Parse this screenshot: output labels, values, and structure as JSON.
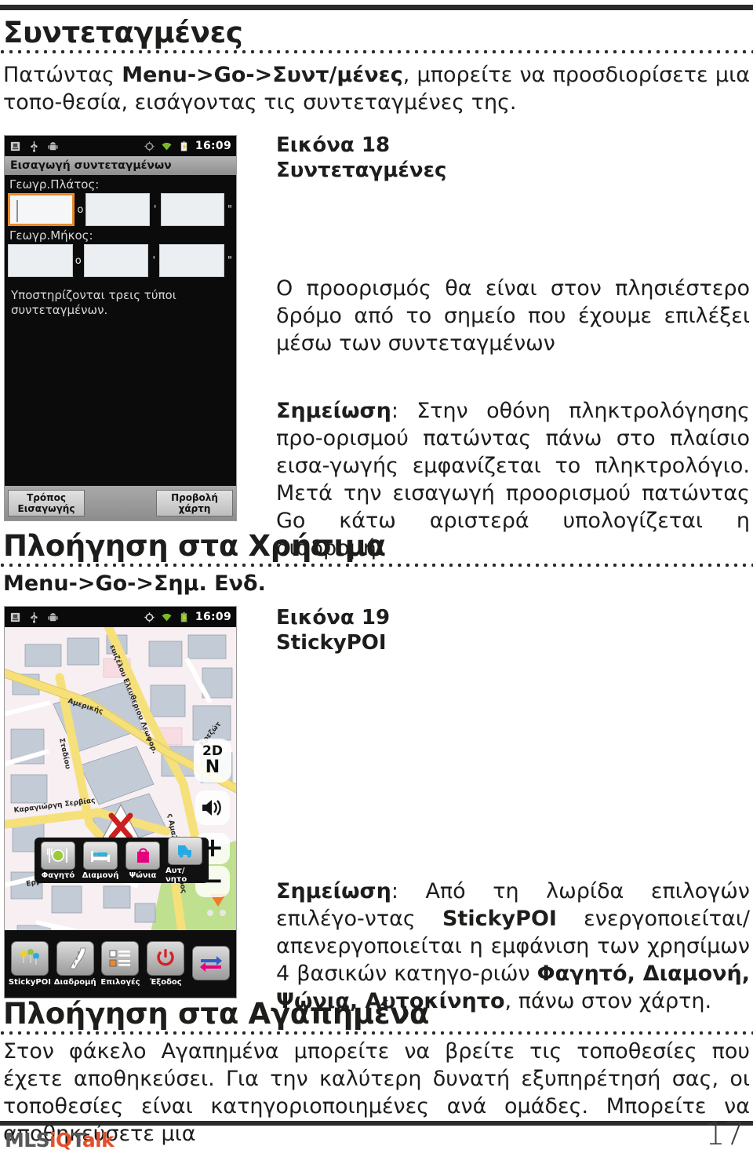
{
  "document": {
    "section1_title": "Συντεταγμένες",
    "intro_before": "Πατώντας ",
    "intro_bold": "Menu->Go->Συντ/μένες",
    "intro_after": ", μπορείτε να προσδιορίσετε μια τοπο-θεσία, εισάγοντας τις συντεταγμένες της.",
    "section2_title": "Πλοήγηση στα Χρήσιμα",
    "menu_path2": "Menu->Go->Σημ. Ενδ.",
    "section3_title": "Πλοήγηση στα Αγαπημένα",
    "outro_text": "Στον φάκελο Αγαπημένα μπορείτε να βρείτε τις τοποθεσίες που έχετε αποθηκεύσει. Για την καλύτερη δυνατή εξυπηρέτησή σας, οι τοποθεσίες είναι κατηγοριοποιημένες ανά ομάδες. Μπορείτε να αποθηκεύσετε μια",
    "page_number": "17"
  },
  "figure18": {
    "caption_line1": "Εικόνα 18",
    "caption_line2": "Συντεταγμένες",
    "body_text": "Ο προορισμός θα είναι στον πλησιέστερο δρόμο από το σημείο που έχουμε επιλέξει μέσω των συντεταγμένων",
    "note_label": "Σημείωση",
    "note_text": ": Στην οθόνη πληκτρολόγησης προ-ορισμού πατώντας πάνω στο πλαίσιο εισα-γωγής εμφανίζεται το πληκτρολόγιο. Μετά την εισαγωγή προορισμού πατώντας Go κάτω αριστερά υπολογίζεται η διαδρομή."
  },
  "figure19": {
    "caption_line1": "Εικόνα 19",
    "caption_line2": "StickyPOI",
    "note_label": "Σημείωση",
    "note_part1": ": Από τη λωρίδα επιλογών επιλέγο-ντας ",
    "note_bold1": "StickyPOI",
    "note_part2": " ενεργοποιείται/απενεργοποιείται η εμφάνιση των χρησίμων 4 βασικών κατηγο-ριών ",
    "note_bold2": "Φαγητό, Διαμονή, Ψώνια, Αυτοκίνητο",
    "note_part3": ", πάνω στον χάρτη."
  },
  "screenshot_coords": {
    "status_time": "16:09",
    "app_title": "Εισαγωγή συντεταγμένων",
    "label_lat": "Γεωγρ.Πλάτος:",
    "label_lon": "Γεωγρ.Μήκος:",
    "unit_deg": "o",
    "unit_min": "'",
    "unit_sec": "\"",
    "hint_text": "Υποστηρίζονται τρεις τύποι συντεταγμένων.",
    "softkey_left_l1": "Τρόπος",
    "softkey_left_l2": "Εισαγωγής",
    "softkey_right_l1": "Προβολή",
    "softkey_right_l2": "χάρτη"
  },
  "screenshot_map": {
    "status_time": "16:09",
    "streets": [
      "Αμερικής",
      "Ελευθερίου Βενιζέλου Λεωφορ.",
      "Σταδίου",
      "Καραγιώργη Σερβίας",
      "Ερμου",
      "Κρεζώτου",
      "Βασιλίσσης Αμαλίας Λεωφορος"
    ],
    "mode_2d": "2D",
    "mode_north": "N",
    "zoom_in": "+",
    "zoom_out": "−",
    "poi_items": [
      {
        "label": "Φαγητό",
        "color": "#9ec93a",
        "icon": "restaurant-icon"
      },
      {
        "label": "Διαμονή",
        "color": "#2bb3e0",
        "icon": "hotel-icon"
      },
      {
        "label": "Ψώνια",
        "color": "#e6007e",
        "icon": "shopping-icon"
      },
      {
        "label": "Αυτ/νητο",
        "color": "#29a9e1",
        "icon": "car-icon"
      }
    ],
    "dock_items": [
      {
        "label": "StickyPOI",
        "icon": "pins-icon"
      },
      {
        "label": "Διαδρομή",
        "icon": "road-icon"
      },
      {
        "label": "Επιλογές",
        "icon": "list-icon"
      },
      {
        "label": "Έξοδος",
        "icon": "power-icon"
      },
      {
        "label": "",
        "icon": "arrows-icon"
      }
    ]
  },
  "footer": {
    "logo_mls": "MLS",
    "logo_iq": "iQ",
    "logo_t": "T",
    "logo_alk": "alk"
  },
  "colors": {
    "accent_orange": "#e2512b",
    "focus_orange": "#e98b29",
    "ink": "#1d1d1b"
  }
}
